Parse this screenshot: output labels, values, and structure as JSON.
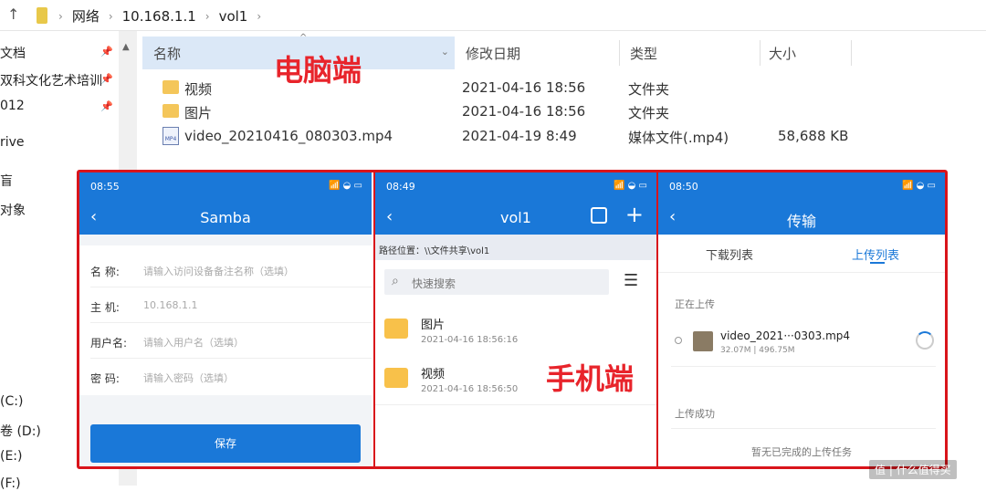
{
  "address": {
    "up_icon": "up-arrow-icon",
    "crumbs": [
      "网络",
      "10.168.1.1",
      "vol1"
    ]
  },
  "nav": {
    "items": [
      "文档",
      "双科文化艺术培训",
      "012",
      "rive",
      "盲",
      "对象",
      " (C:)",
      "卷 (D:)",
      " (E:)",
      " (F:)"
    ]
  },
  "columns": {
    "name": "名称",
    "date": "修改日期",
    "type": "类型",
    "size": "大小"
  },
  "files": [
    {
      "name": "视频",
      "date": "2021-04-16 18:56",
      "type": "文件夹",
      "size": ""
    },
    {
      "name": "图片",
      "date": "2021-04-16 18:56",
      "type": "文件夹",
      "size": ""
    },
    {
      "name": "video_20210416_080303.mp4",
      "date": "2021-04-19 8:49",
      "type": "媒体文件(.mp4)",
      "size": "58,688 KB"
    }
  ],
  "labels": {
    "pc": "电脑端",
    "mobile": "手机端"
  },
  "phone1": {
    "time": "08:55",
    "title": "Samba",
    "fields": [
      {
        "label": "名 称:",
        "value": "请输入访问设备备注名称（选填）"
      },
      {
        "label": "主 机:",
        "value": "10.168.1.1"
      },
      {
        "label": "用户名:",
        "value": "请输入用户名（选填）"
      },
      {
        "label": "密 码:",
        "value": "请输入密码（选填）"
      }
    ],
    "save": "保存"
  },
  "phone2": {
    "time": "08:49",
    "title": "vol1",
    "path": "路径位置：\\\\文件共享\\vol1",
    "search": "快速搜索",
    "items": [
      {
        "name": "图片",
        "date": "2021-04-16 18:56:16"
      },
      {
        "name": "视频",
        "date": "2021-04-16 18:56:50"
      }
    ]
  },
  "phone3": {
    "time": "08:50",
    "title": "传输",
    "tab_download": "下载列表",
    "tab_upload": "上传列表",
    "uploading": "正在上传",
    "file": "video_2021···0303.mp4",
    "progress": "32.07M | 496.75M",
    "progress_fraction": 0.065,
    "done": "上传成功",
    "empty": "暂无已完成的上传任务"
  },
  "watermark": "值 | 什么值得买",
  "colors": {
    "blue": "#1a78d8",
    "red": "#d9141b"
  }
}
